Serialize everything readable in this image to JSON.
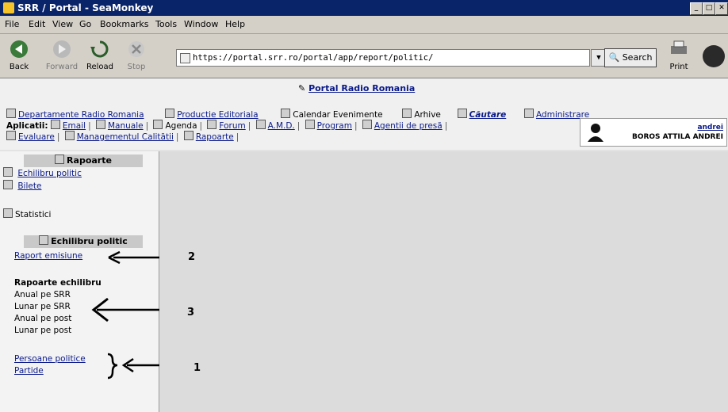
{
  "window": {
    "title": "SRR / Portal - SeaMonkey",
    "min": "_",
    "max": "□",
    "close": "✕"
  },
  "menu": [
    "File",
    "Edit",
    "View",
    "Go",
    "Bookmarks",
    "Tools",
    "Window",
    "Help"
  ],
  "toolbar": {
    "back": "Back",
    "forward": "Forward",
    "reload": "Reload",
    "stop": "Stop",
    "print": "Print",
    "search": "Search"
  },
  "url": "https://portal.srr.ro/portal/app/report/politic/",
  "header": {
    "title": "Portal Radio Romania",
    "row1": [
      "Departamente Radio Romania",
      "Productie Editoriala",
      "Calendar Evenimente",
      "Arhive",
      "Căutare",
      "Administrare"
    ],
    "row2_label": "Aplicatii:",
    "row2": [
      "Email",
      "Manuale",
      "Agenda",
      "Forum",
      "A.M.D.",
      "Program",
      "Agentii de presă"
    ],
    "row3": [
      "Evaluare",
      "Managementul Calitătii",
      "Rapoarte"
    ],
    "user": {
      "login": "andrei",
      "name": "BOROS ATTILA ANDREI"
    }
  },
  "sidebar": {
    "section1_title": "Rapoarte",
    "item_echilibru": "Echilibru politic",
    "item_bilete": "Bilete",
    "item_statistici": "Statistici",
    "section2_title": "Echilibru politic",
    "raport_emisiune": "Raport emisiune",
    "rapoarte_echilibru": "Rapoarte echilibru",
    "anual_srr": "Anual pe SRR",
    "lunar_srr": "Lunar pe SRR",
    "anual_post": "Anual pe post",
    "lunar_post": "Lunar pe post",
    "persoane": "Persoane politice",
    "partide": "Partide"
  },
  "annotations": {
    "a1": "1",
    "a2": "2",
    "a3": "3"
  }
}
